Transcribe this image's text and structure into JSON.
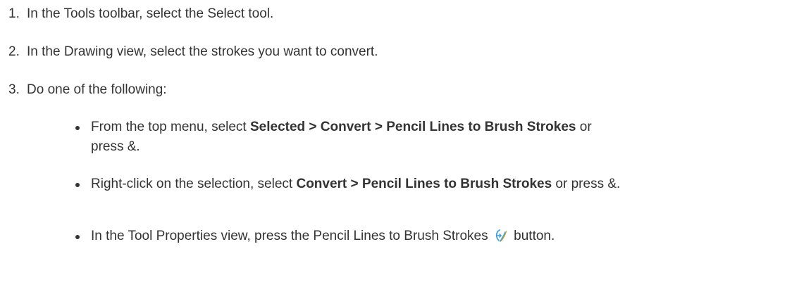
{
  "steps": [
    {
      "num": "1.",
      "text": "In the Tools toolbar, select the Select tool."
    },
    {
      "num": "2.",
      "text": "In the Drawing view, select the strokes you want to convert."
    },
    {
      "num": "3.",
      "text": "Do one of the following:"
    }
  ],
  "options": {
    "menu": {
      "lead": "From the top menu, select ",
      "path": "Selected > Convert > Pencil Lines to Brush Strokes",
      "mid": " or",
      "tail": "press &."
    },
    "context": {
      "lead": "Right-click on the selection, select ",
      "path": "Convert > Pencil Lines to Brush Strokes",
      "tail": " or press &."
    },
    "tool_properties": {
      "lead": "In the Tool Properties view, press the Pencil Lines to Brush Strokes",
      "icon": "pencil-to-brush-icon",
      "tail": "button."
    }
  },
  "colors": {
    "text": "#333333",
    "icon_blue": "#3b9fe0",
    "icon_yellow": "#f2b51d"
  }
}
